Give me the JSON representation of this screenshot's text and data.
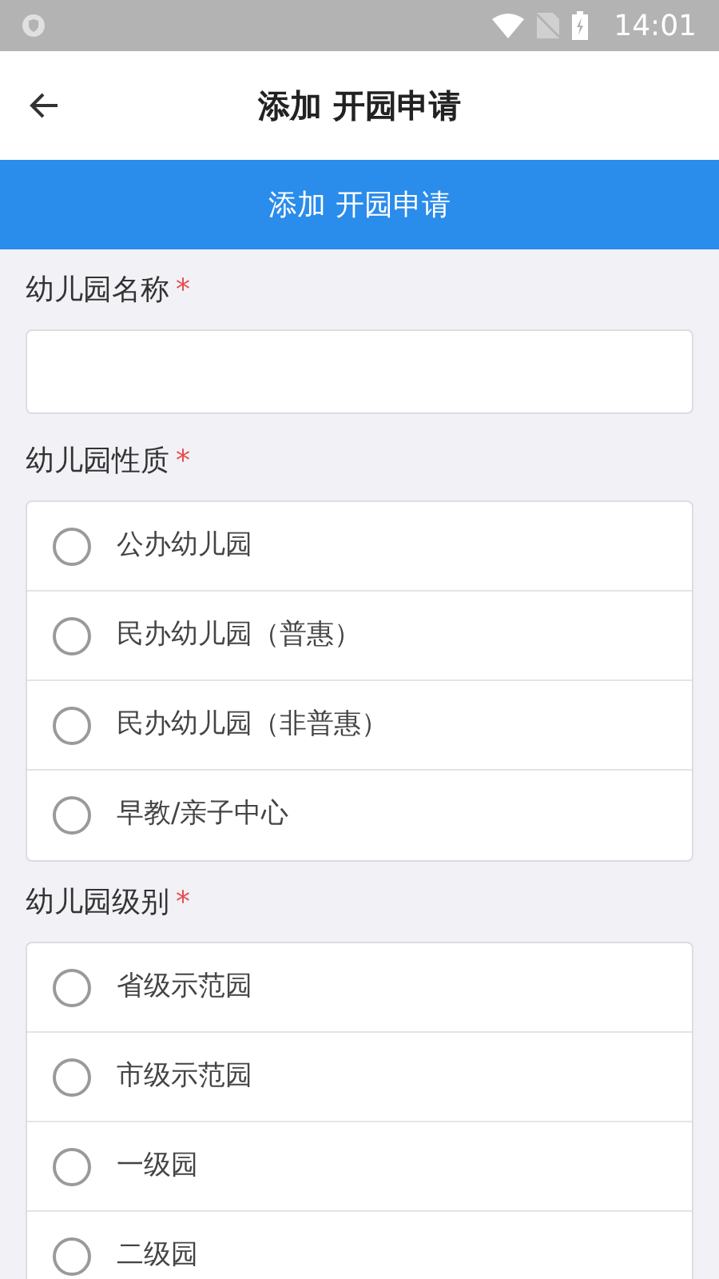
{
  "status_bar": {
    "time": "14:01"
  },
  "app_bar": {
    "title": "添加 开园申请"
  },
  "banner": {
    "title": "添加 开园申请"
  },
  "fields": [
    {
      "kind": "text",
      "label": "幼儿园名称",
      "required_mark": "*"
    },
    {
      "kind": "radio",
      "label": "幼儿园性质",
      "required_mark": "*",
      "options": [
        {
          "label": "公办幼儿园",
          "selected": false
        },
        {
          "label": "民办幼儿园（普惠）",
          "selected": false
        },
        {
          "label": "民办幼儿园（非普惠）",
          "selected": false
        },
        {
          "label": "早教/亲子中心",
          "selected": false
        }
      ]
    },
    {
      "kind": "radio",
      "label": "幼儿园级别",
      "required_mark": "*",
      "options": [
        {
          "label": "省级示范园",
          "selected": false
        },
        {
          "label": "市级示范园",
          "selected": false
        },
        {
          "label": "一级园",
          "selected": false
        },
        {
          "label": "二级园",
          "selected": false
        }
      ]
    }
  ]
}
